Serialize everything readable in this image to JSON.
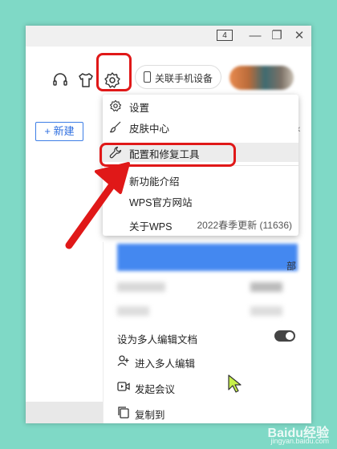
{
  "titlebar": {
    "tab_count": "4",
    "minimize": "—",
    "restore": "❐",
    "close": "✕"
  },
  "toolbar": {
    "link_phone_label": "关联手机设备"
  },
  "left": {
    "new_button": "+ 新建"
  },
  "menu": {
    "items": [
      {
        "label": "设置",
        "icon": "gear-icon"
      },
      {
        "label": "皮肤中心",
        "icon": "brush-icon"
      },
      {
        "label": "配置和修复工具",
        "icon": "wrench-icon"
      },
      {
        "label": "新功能介绍",
        "icon": ""
      },
      {
        "label": "WPS官方网站",
        "icon": ""
      },
      {
        "label": "关于WPS",
        "icon": "",
        "detail": "2022春季更新 (11636)"
      }
    ]
  },
  "main": {
    "edge_text": "部",
    "items": [
      {
        "label": "设为多人编辑文档",
        "icon": ""
      },
      {
        "label": "进入多人编辑",
        "icon": "add-user-icon"
      },
      {
        "label": "发起会议",
        "icon": "video-meeting-icon"
      },
      {
        "label": "复制到",
        "icon": "copy-icon"
      }
    ]
  },
  "watermark": {
    "brand": "Baidu经验",
    "url": "jingyan.baidu.com"
  },
  "colors": {
    "highlight": "#e01818",
    "accent": "#2f6fe0",
    "background": "#7fd9c6"
  }
}
